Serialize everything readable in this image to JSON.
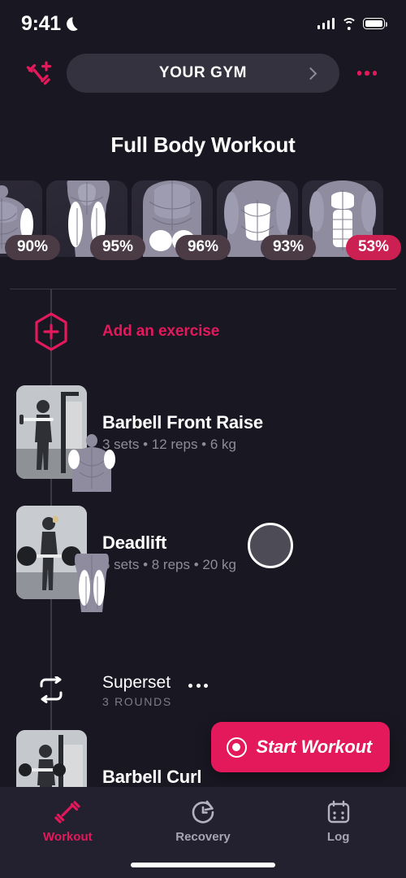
{
  "status_bar": {
    "time": "9:41",
    "moon_icon": "crescent-moon-icon",
    "signal_icon": "cellular-signal-icon",
    "wifi_icon": "wifi-icon",
    "battery_icon": "battery-icon"
  },
  "header": {
    "add_workout_icon": "dumbbell-plus-icon",
    "gym_label": "YOUR GYM",
    "gym_chevron_icon": "chevron-right-icon",
    "overflow_icon": "more-horizontal-icon"
  },
  "page_title": "Full Body Workout",
  "muscle_cards": [
    {
      "name": "chest-arms-card",
      "percent": "90%",
      "low": false
    },
    {
      "name": "quads-card",
      "percent": "95%",
      "low": false
    },
    {
      "name": "glutes-card",
      "percent": "96%",
      "low": false
    },
    {
      "name": "back-card",
      "percent": "93%",
      "low": false
    },
    {
      "name": "abs-card",
      "percent": "53%",
      "low": true
    }
  ],
  "add_exercise": {
    "icon": "hexagon-plus-icon",
    "label": "Add an exercise"
  },
  "exercises": [
    {
      "name": "Barbell Front Raise",
      "meta": "3 sets • 12 reps • 6 kg",
      "thumb": "barbell-front-raise-photo",
      "anat": "shoulders-highlight-icon"
    },
    {
      "name": "Deadlift",
      "meta": "5 sets • 8 reps • 20 kg",
      "thumb": "deadlift-photo",
      "anat": "legs-highlight-icon"
    }
  ],
  "superset": {
    "icon": "repeat-icon",
    "title": "Superset",
    "overflow_icon": "more-horizontal-icon",
    "rounds": "3 ROUNDS",
    "exercise": {
      "name": "Barbell Curl",
      "thumb": "barbell-curl-photo"
    }
  },
  "start_button": {
    "icon": "record-circle-icon",
    "label": "Start Workout"
  },
  "tabs": [
    {
      "label": "Workout",
      "icon": "dumbbell-icon",
      "active": true
    },
    {
      "label": "Recovery",
      "icon": "clock-refresh-icon",
      "active": false
    },
    {
      "label": "Log",
      "icon": "calendar-icon",
      "active": false
    }
  ],
  "colors": {
    "accent": "#e4195c",
    "background": "#191722",
    "tabbar": "#232130",
    "pill": "#34323e",
    "badge": "#4a3b45",
    "badge_low": "#cc1f52",
    "muted_text": "#8e8c99"
  }
}
